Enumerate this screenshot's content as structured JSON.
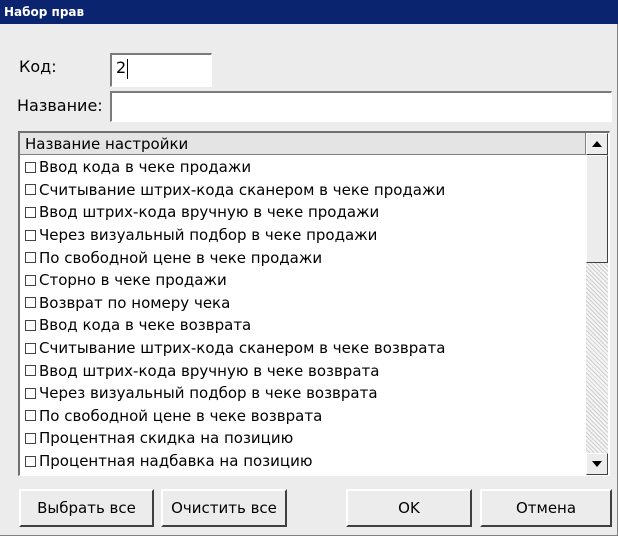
{
  "window": {
    "title": "Набор прав"
  },
  "form": {
    "code_label": "Код:",
    "code_value": "2",
    "name_label": "Название:",
    "name_value": ""
  },
  "list": {
    "header": "Название настройки",
    "items": [
      {
        "label": "Ввод кода в чеке продажи",
        "checked": false
      },
      {
        "label": "Считывание штрих-кода сканером в чеке продажи",
        "checked": false
      },
      {
        "label": "Ввод штрих-кода вручную в чеке продажи",
        "checked": false
      },
      {
        "label": "Через визуальный подбор в чеке продажи",
        "checked": false
      },
      {
        "label": "По свободной цене в чеке продажи",
        "checked": false
      },
      {
        "label": "Сторно в чеке продажи",
        "checked": false
      },
      {
        "label": "Возврат по номеру чека",
        "checked": false
      },
      {
        "label": "Ввод кода в чеке возврата",
        "checked": false
      },
      {
        "label": "Считывание штрих-кода сканером в чеке возврата",
        "checked": false
      },
      {
        "label": "Ввод штрих-кода вручную в чеке возврата",
        "checked": false
      },
      {
        "label": "Через визуальный подбор в чеке возврата",
        "checked": false
      },
      {
        "label": "По свободной цене в чеке возврата",
        "checked": false
      },
      {
        "label": "Процентная скидка на позицию",
        "checked": false
      },
      {
        "label": "Процентная надбавка на позицию",
        "checked": false
      }
    ]
  },
  "buttons": {
    "select_all": "Выбрать все",
    "clear_all": "Очистить все",
    "ok": "OK",
    "cancel": "Отмена"
  }
}
